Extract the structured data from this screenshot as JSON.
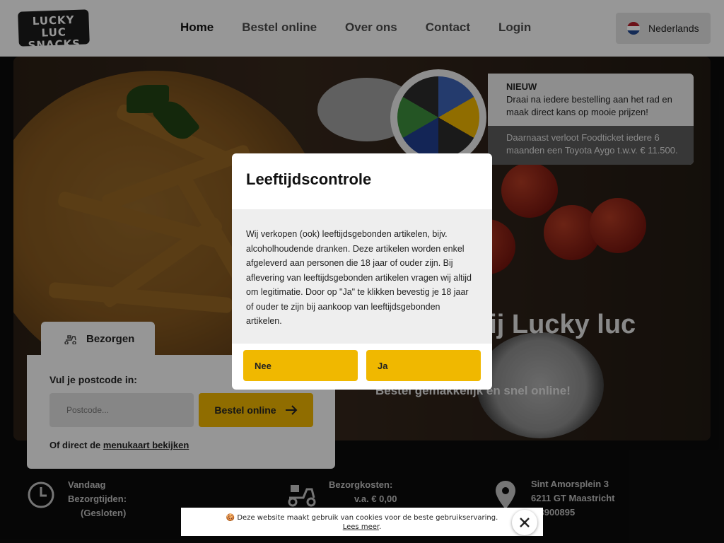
{
  "header": {
    "logo_line1": "LUCKY LUC",
    "logo_line2": "SNACKS",
    "nav": [
      "Home",
      "Bestel online",
      "Over ons",
      "Contact",
      "Login"
    ],
    "language": "Nederlands"
  },
  "hero": {
    "title": "bij Lucky luc",
    "subtitle": "Bestel gemakkelijk en snel online!"
  },
  "promo": {
    "label": "NIEUW",
    "text": "Draai na iedere bestelling aan het rad en maak direct kans op mooie prijzen!",
    "text2": "Daarnaast verloot Foodticket iedere 6 maanden een Toyota Aygo t.w.v. € 11.500."
  },
  "order": {
    "tab": "Bezorgen",
    "postcode_label": "Vul je postcode in:",
    "postcode_placeholder": "Postcode...",
    "order_button": "Bestel online",
    "direct_prefix": "Of direct de",
    "direct_link": "menukaart bekijken"
  },
  "info": {
    "hours_day": "Vandaag",
    "hours_label": "Bezorgtijden:",
    "hours_status": "(Gesloten)",
    "cost_label": "Bezorgkosten:",
    "cost_value": "v.a. € 0,00",
    "address_street": "Sint Amorsplein 3",
    "address_city": "6211 GT Maastricht",
    "phone_visible": "3-3900895"
  },
  "modal": {
    "title": "Leeftijdscontrole",
    "body": "Wij verkopen (ook) leeftijdsgebonden artikelen, bijv. alcoholhoudende dranken. Deze artikelen worden enkel afgeleverd aan personen die 18 jaar of ouder zijn. Bij aflevering van leeftijdsgebonden artikelen vragen wij altijd om legitimatie. Door op \"Ja\" te klikken bevestig je 18 jaar of ouder te zijn bij aankoop van leeftijdsgebonden artikelen.",
    "no": "Nee",
    "yes": "Ja"
  },
  "cookie": {
    "text": "Deze website maakt gebruik van cookies voor de beste gebruikservaring.",
    "link": "Lees meer"
  },
  "colors": {
    "accent": "#e8b000",
    "header_bg": "#f4f4f4",
    "page_bg": "#0b0b0b"
  }
}
